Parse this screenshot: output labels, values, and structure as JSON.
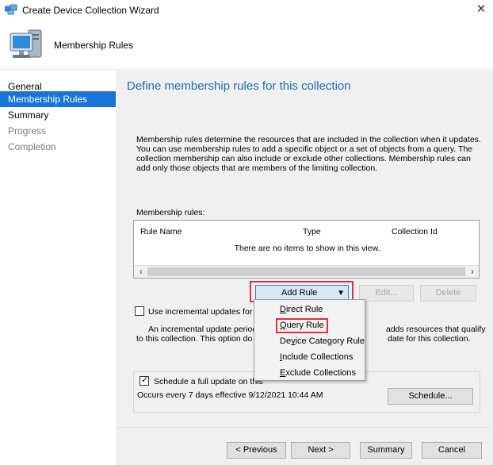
{
  "window": {
    "title": "Create Device Collection Wizard",
    "close_glyph": "✕",
    "icon": "wizard-computers-icon"
  },
  "banner": {
    "title": "Membership Rules",
    "icon": "computer-monitor-icon"
  },
  "nav": {
    "steps": [
      {
        "label": "General",
        "state": "normal"
      },
      {
        "label": "Membership Rules",
        "state": "active"
      },
      {
        "label": "Summary",
        "state": "normal"
      },
      {
        "label": "Progress",
        "state": "disabled"
      },
      {
        "label": "Completion",
        "state": "disabled"
      }
    ]
  },
  "page": {
    "heading": "Define membership rules for this collection",
    "description": "Membership rules determine the resources that are included in the collection when it updates. You can use membership rules to add a specific object or a set of objects from a query. The collection membership can also include or exclude other collections. Membership rules can add only those objects that are members of the limiting collection.",
    "rules_label": "Membership rules:",
    "columns": [
      "Rule Name",
      "Type",
      "Collection Id"
    ],
    "empty_text": "There are no items to show in this view."
  },
  "actions": {
    "add_rule": "Add Rule",
    "edit": "Edit...",
    "delete": "Delete"
  },
  "add_rule_menu": [
    {
      "label": "Direct Rule",
      "mnemonic": "D",
      "rest": "irect Rule"
    },
    {
      "label": "Query Rule",
      "mnemonic": "Q",
      "rest": "uery Rule"
    },
    {
      "label": "Device Category Rule",
      "pre": "De",
      "mnemonic": "v",
      "rest": "ice Category Rule"
    },
    {
      "label": "Include Collections",
      "mnemonic": "I",
      "rest": "nclude Collections"
    },
    {
      "label": "Exclude Collections",
      "mnemonic": "E",
      "rest": "xclude Collections"
    }
  ],
  "incremental": {
    "checked": false,
    "label_visible": "Use incremental updates for this",
    "desc_left_1": "An incremental update periodic",
    "desc_left_2": "to this collection. This option do",
    "desc_right_1": "adds resources that qualify",
    "desc_right_2": "date for this collection."
  },
  "schedule": {
    "checked": true,
    "label_visible": "Schedule a full update on this",
    "summary": "Occurs every 7 days effective 9/12/2021 10:44 AM",
    "button": "Schedule..."
  },
  "footer": {
    "previous": "< Previous",
    "next": "Next >",
    "summary": "Summary",
    "cancel": "Cancel"
  },
  "colors": {
    "accent": "#1874d6",
    "heading": "#1a6fb5",
    "highlight": "#e0313b",
    "panel": "#f0f0f0"
  }
}
